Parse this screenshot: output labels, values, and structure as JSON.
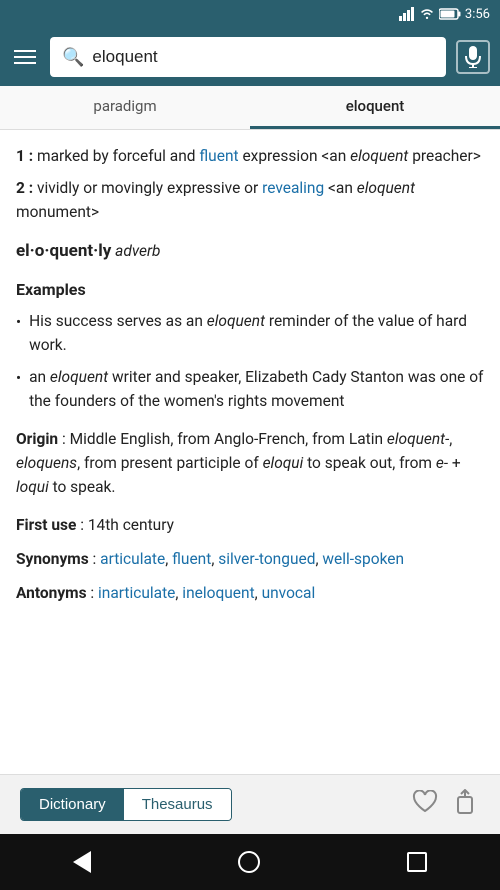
{
  "statusBar": {
    "time": "3:56",
    "icons": [
      "signal",
      "wifi",
      "battery"
    ]
  },
  "searchBar": {
    "query": "eloquent",
    "placeholder": "Search"
  },
  "tabs": [
    {
      "id": "paradigm",
      "label": "paradigm",
      "active": false
    },
    {
      "id": "eloquent",
      "label": "eloquent",
      "active": true
    }
  ],
  "content": {
    "definitions": [
      {
        "num": "1",
        "text_before": " : marked by forceful and ",
        "link1": "fluent",
        "text_after": " expression <an ",
        "italic1": "eloquent",
        "text_end": " preacher>"
      },
      {
        "num": "2",
        "text_before": " : vividly or movingly expressive or ",
        "link1": "revealing",
        "text_after": " <an ",
        "italic1": "eloquent",
        "text_end": " monument>"
      }
    ],
    "adverb": {
      "word": "el·o·quent·ly",
      "pos": "adverb"
    },
    "examples": {
      "title": "Examples",
      "items": [
        {
          "bullet": "•",
          "text_before": "His success serves as an ",
          "italic": "eloquent",
          "text_after": " reminder of the value of hard work."
        },
        {
          "bullet": "•",
          "text_before": "an ",
          "italic": "eloquent",
          "text_after": " writer and speaker, Elizabeth Cady Stanton was one of the founders of the women's rights movement"
        }
      ]
    },
    "origin": {
      "label": "Origin",
      "text_before": ": Middle English, from Anglo-French, from Latin ",
      "italic1": "eloquent-",
      "sep": ", ",
      "italic2": "eloquens",
      "text_mid": ", from present participle of ",
      "italic3": "eloqui",
      "text_after": " to speak out, from ",
      "italic4": "e-",
      "text_plus": " + ",
      "italic5": "loqui",
      "text_end": " to speak."
    },
    "firstUse": {
      "label": "First use",
      "value": ": 14th century"
    },
    "synonyms": {
      "label": "Synonyms",
      "links": [
        "articulate",
        "fluent",
        "silver-tongued",
        "well-spoken"
      ]
    },
    "antonyms": {
      "label": "Antonyms",
      "links": [
        "inarticulate",
        "ineloquent",
        "unvocal"
      ]
    }
  },
  "bottomToolbar": {
    "dictionaryLabel": "Dictionary",
    "thesaurusLabel": "Thesaurus",
    "activeTab": "dictionary"
  },
  "colors": {
    "teal": "#2a5f6e",
    "linkBlue": "#1a6fa8"
  }
}
